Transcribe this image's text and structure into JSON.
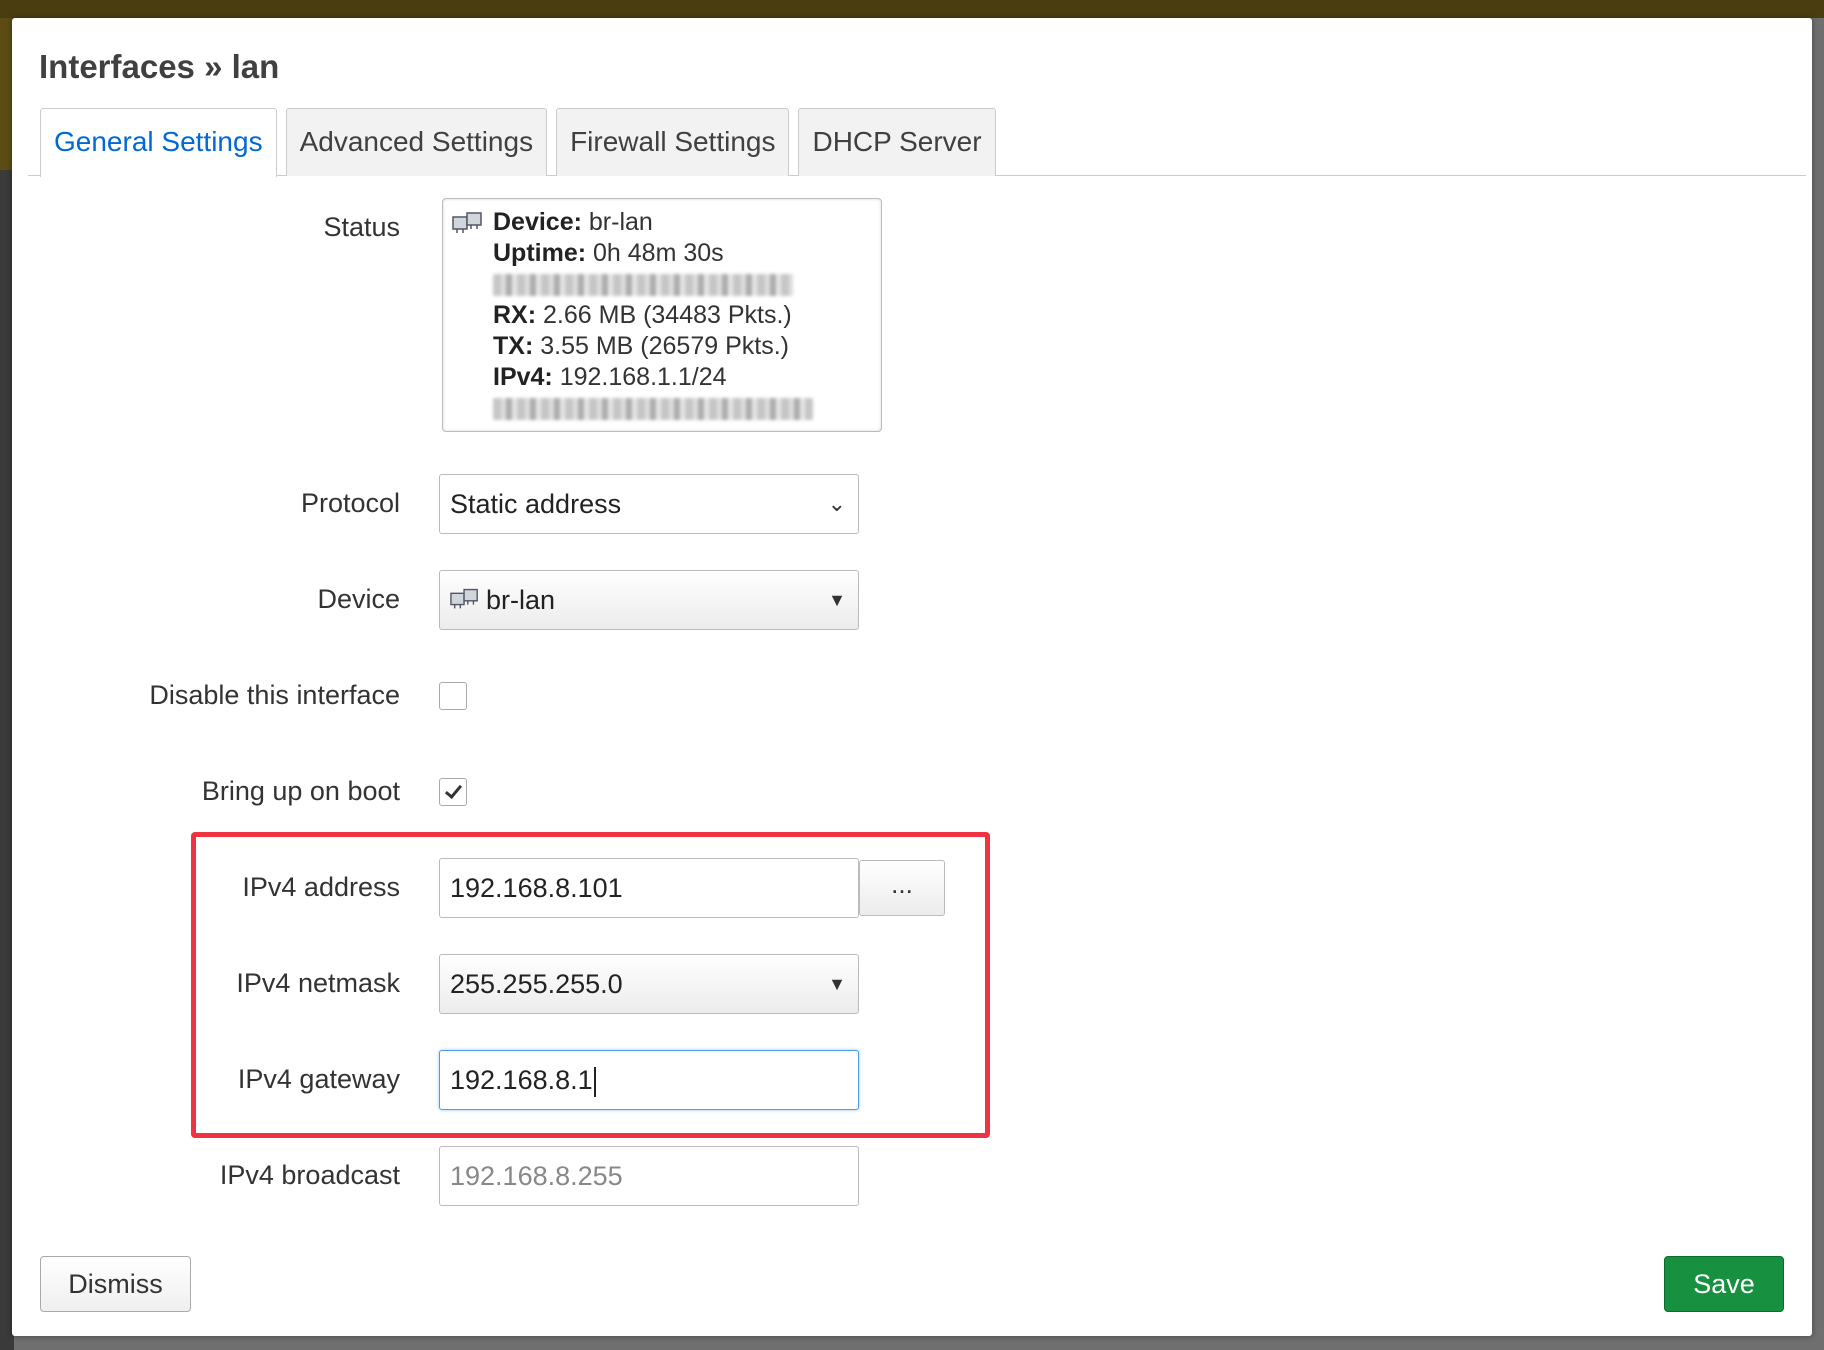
{
  "dialog": {
    "title": "Interfaces » lan"
  },
  "tabs": [
    {
      "label": "General Settings",
      "active": true
    },
    {
      "label": "Advanced Settings",
      "active": false
    },
    {
      "label": "Firewall Settings",
      "active": false
    },
    {
      "label": "DHCP Server",
      "active": false
    }
  ],
  "status": {
    "label": "Status",
    "device_key": "Device:",
    "device_value": "br-lan",
    "uptime_key": "Uptime:",
    "uptime_value": "0h 48m 30s",
    "rx_key": "RX:",
    "rx_value": "2.66 MB (34483 Pkts.)",
    "tx_key": "TX:",
    "tx_value": "3.55 MB (26579 Pkts.)",
    "ipv4_key": "IPv4:",
    "ipv4_value": "192.168.1.1/24"
  },
  "protocol": {
    "label": "Protocol",
    "value": "Static address"
  },
  "device": {
    "label": "Device",
    "value": "br-lan",
    "icon": "network-device-icon"
  },
  "disable_interface": {
    "label": "Disable this interface",
    "checked": false
  },
  "bring_up_on_boot": {
    "label": "Bring up on boot",
    "checked": true
  },
  "ipv4_address": {
    "label": "IPv4 address",
    "value": "192.168.8.101",
    "more_label": "..."
  },
  "ipv4_netmask": {
    "label": "IPv4 netmask",
    "value": "255.255.255.0"
  },
  "ipv4_gateway": {
    "label": "IPv4 gateway",
    "value": "192.168.8.1"
  },
  "ipv4_broadcast": {
    "label": "IPv4 broadcast",
    "placeholder": "192.168.8.255"
  },
  "footer": {
    "dismiss_label": "Dismiss",
    "save_label": "Save"
  },
  "colors": {
    "tab_active_text": "#0069d6",
    "highlight_border": "#ef3340",
    "save_button": "#17913f"
  }
}
